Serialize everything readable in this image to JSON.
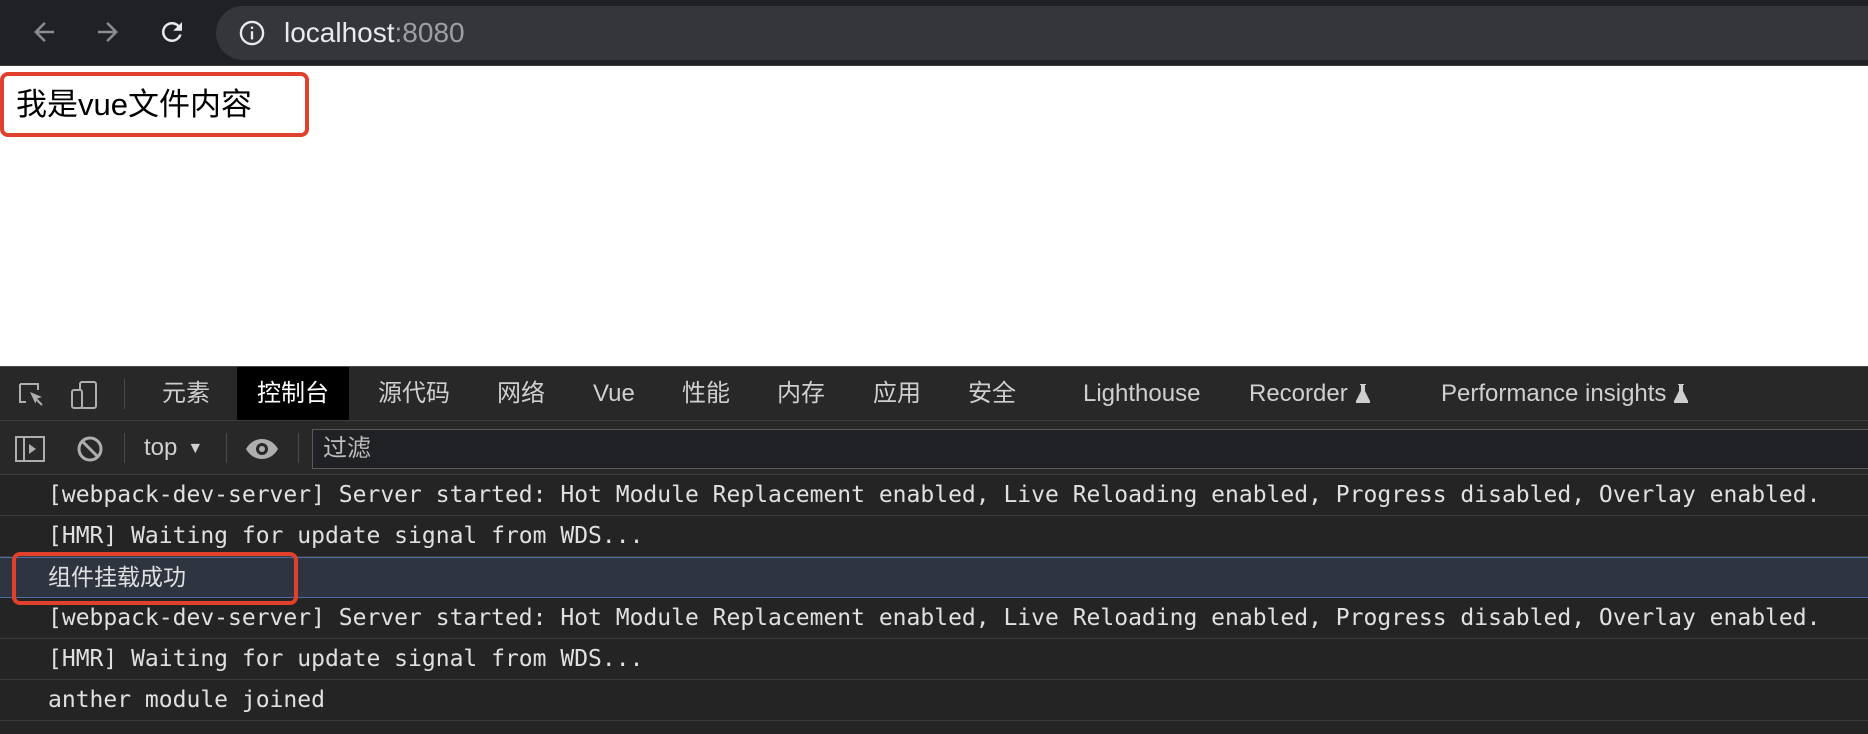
{
  "browser": {
    "url_host": "localhost",
    "url_port": ":8080",
    "icons": [
      "back-arrow",
      "forward-arrow",
      "reload",
      "info-circle"
    ]
  },
  "page": {
    "content_text": "我是vue文件内容"
  },
  "devtools": {
    "tabs": [
      {
        "label": "元素",
        "active": false
      },
      {
        "label": "控制台",
        "active": true
      },
      {
        "label": "源代码",
        "active": false
      },
      {
        "label": "网络",
        "active": false
      },
      {
        "label": "Vue",
        "active": false
      },
      {
        "label": "性能",
        "active": false
      },
      {
        "label": "内存",
        "active": false
      },
      {
        "label": "应用",
        "active": false
      },
      {
        "label": "安全",
        "active": false
      },
      {
        "label": "Lighthouse",
        "active": false
      },
      {
        "label": "Recorder",
        "active": false,
        "experimental": true
      },
      {
        "label": "Performance insights",
        "active": false,
        "experimental": true
      }
    ],
    "context": "top",
    "filter_placeholder": "过滤",
    "console_lines": [
      "[webpack-dev-server] Server started: Hot Module Replacement enabled, Live Reloading enabled, Progress disabled, Overlay enabled.",
      "[HMR] Waiting for update signal from WDS...",
      "组件挂载成功",
      "[webpack-dev-server] Server started: Hot Module Replacement enabled, Live Reloading enabled, Progress disabled, Overlay enabled.",
      "[HMR] Waiting for update signal from WDS...",
      "anther module joined"
    ]
  },
  "colors": {
    "highlight": "#e0402c",
    "toolbar_bg": "#202124",
    "devtools_bg": "#242424",
    "active_tab_bg": "#000000"
  }
}
